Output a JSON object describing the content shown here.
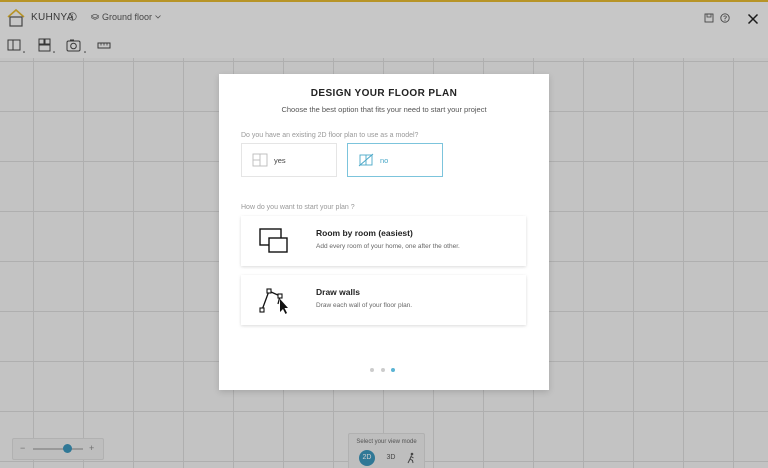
{
  "header": {
    "project_name": "KUHNYA",
    "floor_label": "Ground floor"
  },
  "modal": {
    "title": "DESIGN YOUR FLOOR PLAN",
    "subtitle": "Choose the best option that fits your need to start your project",
    "question_existing_plan": "Do you have an existing 2D floor plan to use as a model?",
    "options": [
      {
        "label": "yes",
        "selected": false
      },
      {
        "label": "no",
        "selected": true
      }
    ],
    "question_start": "How do you want to start your plan ?",
    "cards": [
      {
        "title": "Room by room (easiest)",
        "description": "Add every room of your home, one after the other.",
        "icon": "room-by-room-icon"
      },
      {
        "title": "Draw walls",
        "description": "Draw each wall of your floor plan.",
        "icon": "draw-walls-icon"
      }
    ],
    "pagination": {
      "total": 3,
      "current": 3
    }
  },
  "view_mode": {
    "label": "Select your view mode",
    "option_2d": "2D",
    "option_3d": "3D",
    "active": "2D"
  },
  "zoom": {
    "level_fraction": 0.7
  },
  "colors": {
    "accent": "#3b93b8",
    "selected_border": "#7cc4dc",
    "top_accent": "#e0b530"
  }
}
